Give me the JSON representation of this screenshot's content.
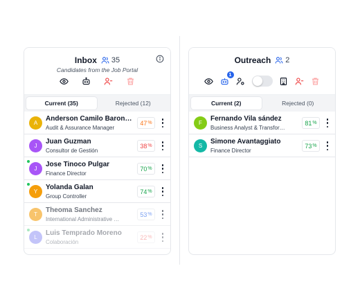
{
  "inbox": {
    "title": "Inbox",
    "count": "35",
    "subtitle": "Candidates from the Job Portal",
    "tabs": [
      {
        "label": "Current (35)",
        "active": true
      },
      {
        "label": "Rejected (12)",
        "active": false
      }
    ],
    "candidates": [
      {
        "initial": "A",
        "name": "Anderson Camilo Baron…",
        "role": "Audit & Assurance Manager",
        "score": "47",
        "pct": "%",
        "avatar_color": "#eab308",
        "score_color": "#f97316",
        "online": false
      },
      {
        "initial": "J",
        "name": "Juan Guzman",
        "role": "Consultor de Gestión",
        "score": "38",
        "pct": "%",
        "avatar_color": "#a855f7",
        "score_color": "#ef4444",
        "online": false
      },
      {
        "initial": "J",
        "name": "Jose Tinoco Pulgar",
        "role": "Finance Director",
        "score": "70",
        "pct": "%",
        "avatar_color": "#a855f7",
        "score_color": "#16a34a",
        "online": true
      },
      {
        "initial": "Y",
        "name": "Yolanda Galan",
        "role": "Group Controller",
        "score": "74",
        "pct": "%",
        "avatar_color": "#f59e0b",
        "score_color": "#16a34a",
        "online": true
      },
      {
        "initial": "T",
        "name": "Theoma Sanchez",
        "role": "International Administrative …",
        "score": "53",
        "pct": "%",
        "avatar_color": "#f59e0b",
        "score_color": "#2563eb",
        "online": false
      },
      {
        "initial": "L",
        "name": "Luis Temprado Moreno",
        "role": "Colaboración",
        "score": "22",
        "pct": "%",
        "avatar_color": "#6366f1",
        "score_color": "#ef4444",
        "online": true
      }
    ]
  },
  "outreach": {
    "title": "Outreach",
    "count": "2",
    "badge": "1",
    "tabs": [
      {
        "label": "Current (2)",
        "active": true
      },
      {
        "label": "Rejected (0)",
        "active": false
      }
    ],
    "candidates": [
      {
        "initial": "F",
        "name": "Fernando Vila sández",
        "role": "Business Analyst & Transfor…",
        "score": "81",
        "pct": "%",
        "avatar_color": "#84cc16",
        "score_color": "#16a34a",
        "online": false
      },
      {
        "initial": "S",
        "name": "Simone Avantaggiato",
        "role": "Finance Director",
        "score": "73",
        "pct": "%",
        "avatar_color": "#14b8a6",
        "score_color": "#16a34a",
        "online": false
      }
    ]
  }
}
